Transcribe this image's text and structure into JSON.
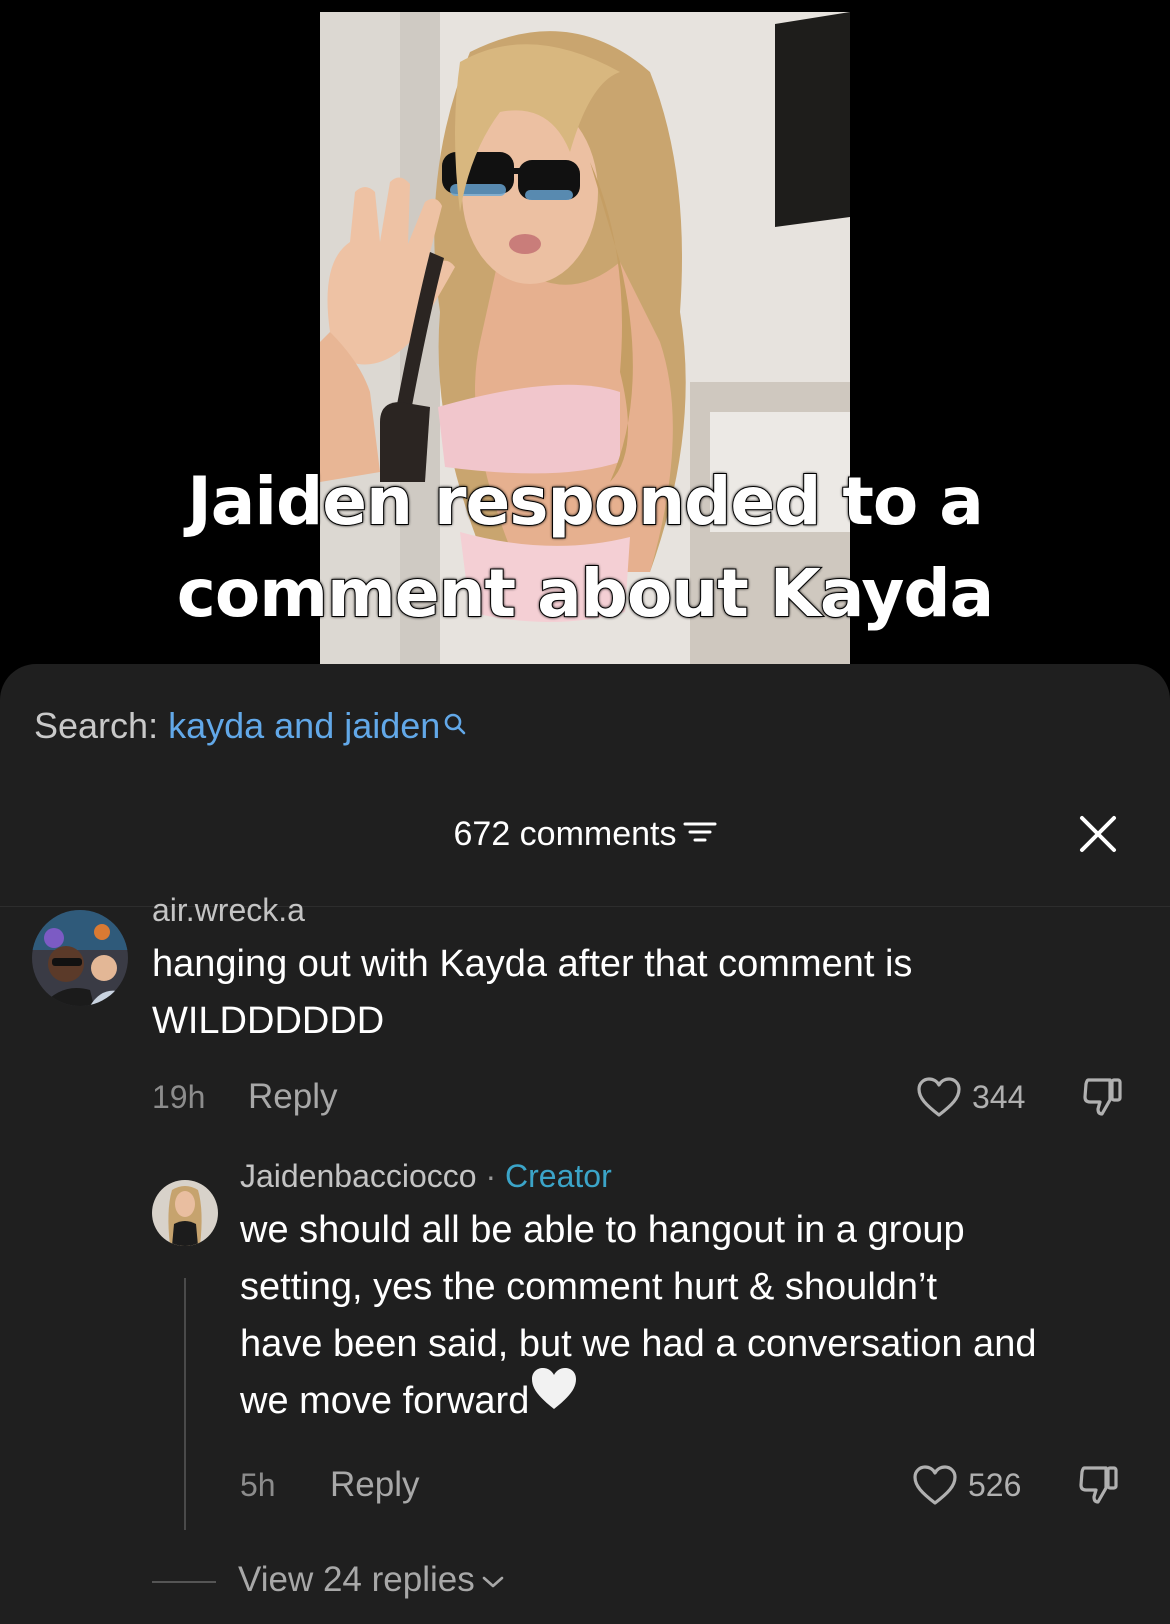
{
  "video": {
    "caption_line1": "Jaiden responded to a",
    "caption_line2": "comment about Kayda"
  },
  "search": {
    "label": "Search:",
    "query": "kayda and jaiden",
    "icon": "search-icon"
  },
  "comments_header": {
    "count_label": "672 comments",
    "filter_icon": "filter-icon",
    "close_icon": "close-icon"
  },
  "comments": [
    {
      "username": "air.wreck.a",
      "text_line1": "hanging out with Kayda after that comment is",
      "text_line2": "WILDDDDDD",
      "time": "19h",
      "reply_label": "Reply",
      "likes": "344"
    }
  ],
  "reply": {
    "username": "Jaidenbacciocco",
    "separator": "·",
    "badge": "Creator",
    "text_line1": "we should all be able to hangout in a group",
    "text_line2": "setting, yes the comment hurt & shouldn’t",
    "text_line3": "have been said, but we had a conversation and",
    "text_line4": "we move forward",
    "heart_emoji": "🤍",
    "time": "5h",
    "reply_label": "Reply",
    "likes": "526"
  },
  "view_replies": "View 24 replies",
  "colors": {
    "sheet_bg": "#1f1f1f",
    "link_blue": "#62a8e8",
    "creator_teal": "#3ba4c8"
  }
}
